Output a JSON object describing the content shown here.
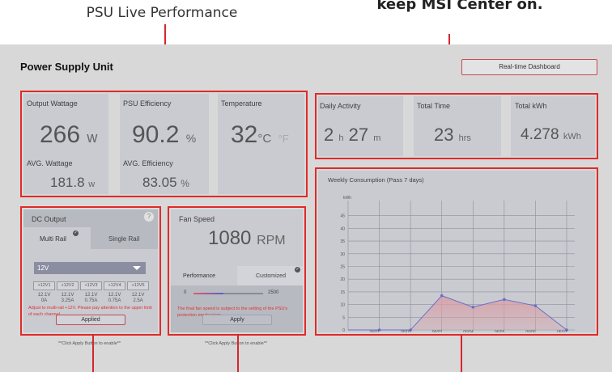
{
  "callouts": {
    "left": "PSU Live Performance",
    "right": "keep MSI Center on."
  },
  "header": {
    "title": "Power Supply Unit",
    "dashboard_button": "Real-time Dashboard"
  },
  "live": {
    "output_wattage": {
      "label": "Output Wattage",
      "value": "266",
      "unit": "w"
    },
    "avg_wattage": {
      "label": "AVG. Wattage",
      "value": "181.8",
      "unit": "w"
    },
    "psu_efficiency": {
      "label": "PSU Efficiency",
      "value": "90.2",
      "unit": "%"
    },
    "avg_efficiency": {
      "label": "AVG. Efficiency",
      "value": "83.05",
      "unit": "%"
    },
    "temperature": {
      "label": "Temperature",
      "value": "32",
      "unit_c": "°C",
      "unit_f": "°F"
    }
  },
  "activity": {
    "daily": {
      "label": "Daily Activity",
      "hours": "2",
      "h": "h",
      "minutes": "27",
      "m": "m"
    },
    "total_time": {
      "label": "Total Time",
      "value": "23",
      "unit": "hrs"
    },
    "total_kwh": {
      "label": "Total kWh",
      "value": "4.278",
      "unit": "kWh"
    }
  },
  "dc_output": {
    "title": "DC Output",
    "help_icon": "?",
    "tabs": [
      "Multi Rail",
      "Single Rail"
    ],
    "selected_rail": "12V",
    "rails": [
      "+12V1",
      "+12V2",
      "+12V3",
      "+12V4",
      "+12V5"
    ],
    "volts": [
      "12.1V",
      "12.1V",
      "12.1V",
      "12.1V",
      "12.1V"
    ],
    "amps": [
      "0A",
      "3.25A",
      "0.75A",
      "0.75A",
      "2.5A"
    ],
    "warning": "Adjust to multi-rail +12V. Please pay attention to the upper limit of each channel.",
    "button": "Applied",
    "footnote": "**Click Apply Button to enable**"
  },
  "fan": {
    "title": "Fan Speed",
    "value": "1080",
    "unit": "RPM",
    "tabs": [
      "Performance",
      "Customized"
    ],
    "slider_min": "0",
    "slider_max": "2500",
    "slider_level": 0.432,
    "note": "The final fan speed is subject to the setting of the PSU's protection mechanism.",
    "button": "Apply",
    "footnote": "**Click Apply Button to enable**"
  },
  "chart_data": {
    "type": "area",
    "title": "Weekly Consumption (Pass 7 days)",
    "ylabel": "kWh",
    "ylim": [
      0,
      50
    ],
    "yticks": [
      0,
      5,
      10,
      15,
      20,
      25,
      30,
      35,
      40,
      45
    ],
    "categories": [
      "06/01",
      "06/02",
      "06/03",
      "06/04",
      "06/05",
      "06/06",
      "06/07"
    ],
    "today_label": "Today",
    "values": [
      0,
      0,
      13.5,
      9,
      12,
      9.5,
      0
    ],
    "line_color": "#6a6fc8",
    "fill_color": "#d9a0a8"
  }
}
